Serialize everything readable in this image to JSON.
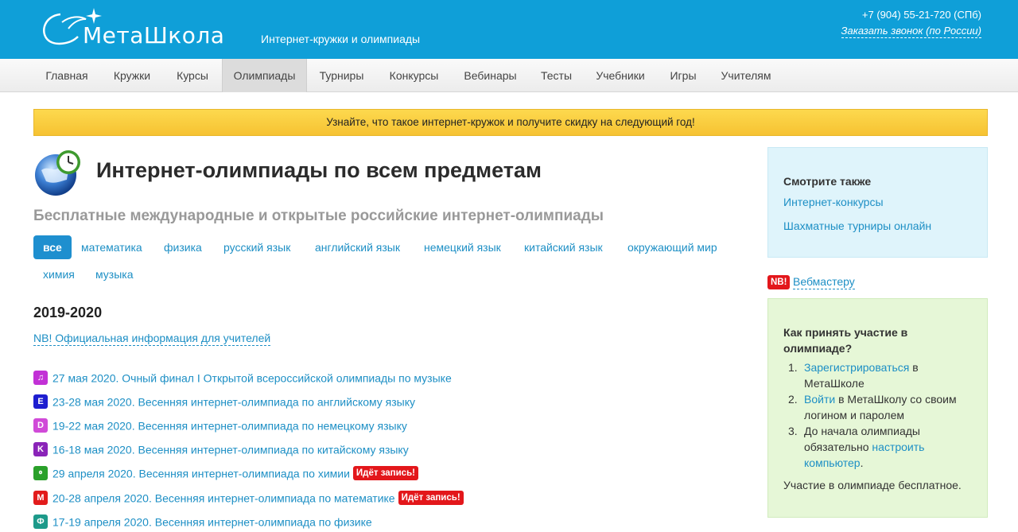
{
  "header": {
    "logo_text": "МетаШкола",
    "tagline": "Интернет-кружки и олимпиады",
    "phone": "+7 (904) 55-21-720 (СПб)",
    "callback": "Заказать звонок (по России)",
    "bg_color": "#0f9fd8"
  },
  "nav": {
    "items": [
      "Главная",
      "Кружки",
      "Курсы",
      "Олимпиады",
      "Турниры",
      "Конкурсы",
      "Вебинары",
      "Тесты",
      "Учебники",
      "Игры",
      "Учителям"
    ],
    "active": "Олимпиады"
  },
  "banner": {
    "text": "Узнайте, что такое интернет-кружок и получите скидку на следующий год!"
  },
  "main": {
    "title": "Интернет-олимпиады по всем предметам",
    "subtitle": "Бесплатные международные и открытые российские интернет-олимпиады",
    "filters": [
      "все",
      "математика",
      "физика",
      "русский язык",
      "английский язык",
      "немецкий язык",
      "китайский язык",
      "окружающий мир",
      "химия",
      "музыка"
    ],
    "year": "2019-2020",
    "nb_link": "NB! Официальная информация для учителей",
    "events": [
      {
        "icon": "♫",
        "icon_color": "#c231d6",
        "text": "27 мая 2020. Очный финал I Открытой всероссийской олимпиады по музыке",
        "badge": ""
      },
      {
        "icon": "E",
        "icon_color": "#1e1ed0",
        "text": "23-28 мая 2020. Весенняя интернет-олимпиада по английскому языку",
        "badge": ""
      },
      {
        "icon": "D",
        "icon_color": "#d04ad8",
        "text": "19-22 мая 2020. Весенняя интернет-олимпиада по немецкому языку",
        "badge": ""
      },
      {
        "icon": "K",
        "icon_color": "#8a24b8",
        "text": "16-18 мая 2020. Весенняя интернет-олимпиада по китайскому языку",
        "badge": ""
      },
      {
        "icon": "⚬",
        "icon_color": "#2aa02a",
        "text": "29 апреля 2020. Весенняя интернет-олимпиада по химии",
        "badge": "Идёт запись!"
      },
      {
        "icon": "M",
        "icon_color": "#e21c1c",
        "text": "20-28 апреля 2020. Весенняя интернет-олимпиада по математике",
        "badge": "Идёт запись!"
      },
      {
        "icon": "Ф",
        "icon_color": "#1d9a8a",
        "text": "17-19 апреля 2020. Весенняя интернет-олимпиада по физике",
        "badge": ""
      }
    ]
  },
  "sidebar": {
    "see_also_title": "Смотрите также",
    "see_also_links": [
      "Интернет-конкурсы",
      "Шахматные турниры онлайн"
    ],
    "nb_badge": "NB!",
    "webmaster": "Вебмастеру",
    "howto_title": "Как принять участие в олимпиаде?",
    "steps": [
      {
        "num": "1.",
        "link": "Зарегистрироваться",
        "text": " в МетаШколе",
        "link2": "",
        "text2": ""
      },
      {
        "num": "2.",
        "link": "Войти",
        "text": " в МетаШколу со своим логином и паролем",
        "link2": "",
        "text2": ""
      },
      {
        "num": "3.",
        "link": "",
        "text": "До начала олимпиады обязательно ",
        "link2": "настроить компьютер",
        "text2": "."
      }
    ],
    "free_note": "Участие в олимпиаде бесплатное."
  }
}
